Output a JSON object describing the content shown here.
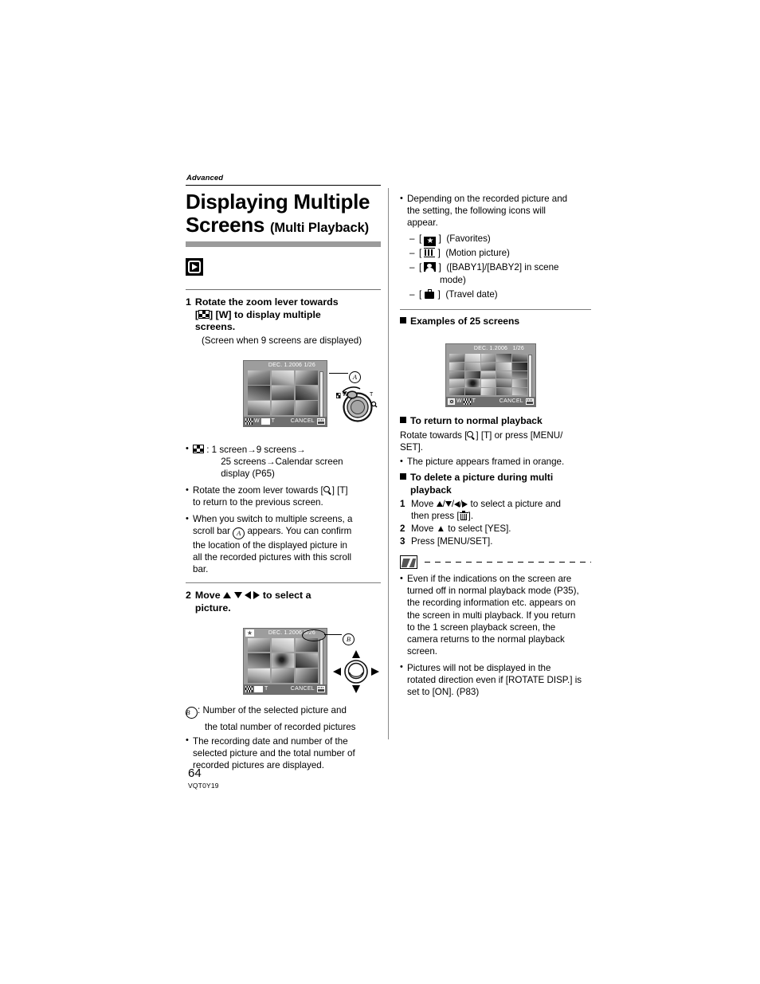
{
  "page": {
    "kicker": "Advanced",
    "number": "64",
    "doc_code": "VQT0Y19"
  },
  "title": {
    "main": "Displaying Multiple Screens",
    "line1": "Displaying Multiple",
    "line2": "Screens",
    "sub": "(Multi Playback)"
  },
  "left": {
    "step1": {
      "num": "1",
      "text_a": "Rotate the zoom lever towards",
      "text_b": "] [W] to display multiple",
      "text_c": "screens.",
      "bracket_open": "[",
      "caption": "(Screen when 9 screens are displayed)"
    },
    "fig1": {
      "date": "DEC. 1.2006",
      "count": "1/26",
      "bottom_w": "W",
      "bottom_t": "T",
      "cancel": "CANCEL",
      "callout": "A"
    },
    "bullets": [
      {
        "icon": "multi-screen-icon",
        "lines": [
          ": 1 screen→9 screens→",
          "25 screens→Calendar screen",
          "display (P65)"
        ]
      },
      {
        "icon": "magnify-icon",
        "lines": [
          "Rotate the zoom lever towards [",
          "] [T]",
          "to return to the previous screen."
        ]
      },
      {
        "icon": "circle-a",
        "lines": [
          "When you switch to multiple screens, a",
          "scroll bar ",
          " appears. You can confirm",
          "the location of the displayed picture in",
          "all the recorded pictures with this scroll",
          "bar."
        ]
      }
    ],
    "step2": {
      "num": "2",
      "text_a": "Move",
      "text_b": "to select a",
      "text_c": "picture."
    },
    "fig2": {
      "date": "DEC. 1.2006",
      "count": "5/26",
      "bottom_t": "T",
      "cancel": "CANCEL",
      "callout": "B"
    },
    "after_fig2": [
      {
        "label": "B",
        "lines": [
          ": Number of the selected picture and",
          "the total number of recorded pictures"
        ]
      },
      {
        "lines": [
          "The recording date and number of the",
          "selected picture and the total number of",
          "recorded pictures are displayed."
        ]
      }
    ]
  },
  "right": {
    "intro_bullet": [
      "Depending on the recorded picture and",
      "the setting, the following icons will",
      "appear."
    ],
    "icon_list": [
      {
        "icon": "favorites-icon",
        "label": "(Favorites)",
        "cont": ""
      },
      {
        "icon": "motion-picture-icon",
        "label": "(Motion picture)",
        "cont": ""
      },
      {
        "icon": "baby-icon",
        "label": "([BABY1]/[BABY2] in scene",
        "cont": "mode)"
      },
      {
        "icon": "travel-date-icon",
        "label": "(Travel date)",
        "cont": ""
      }
    ],
    "sec_examples": "Examples of 25 screens",
    "fig3": {
      "date": "DEC. 1.2006",
      "count": "1/26",
      "bottom_w": "W",
      "bottom_t": "T",
      "cancel": "CANCEL"
    },
    "sec_return": "To return to normal playback",
    "return_text_a": "Rotate towards [",
    "return_text_b": "] [T] or press [MENU/",
    "return_text_c": "SET].",
    "return_bullet": "The picture appears framed in orange.",
    "sec_delete_l1": "To delete a picture during multi",
    "sec_delete_l2": "playback",
    "delete_steps": [
      {
        "n": "1",
        "a": "Move ",
        "b": " to select a picture and",
        "c": "then press [",
        "d": "]."
      },
      {
        "n": "2",
        "t": "Move ▲ to select [YES]."
      },
      {
        "n": "3",
        "t": "Press [MENU/SET]."
      }
    ],
    "notes": [
      [
        "Even if the indications on the screen are",
        "turned off in normal playback mode (P35),",
        "the recording information etc. appears on",
        "the screen in multi playback. If you return",
        "to the 1 screen playback screen, the",
        "camera returns to the normal playback",
        "screen."
      ],
      [
        "Pictures will not be displayed in the",
        "rotated direction even if [ROTATE DISP.] is",
        "set to [ON]. (P83)"
      ]
    ]
  },
  "colors": {
    "screen_bg": "#9d9d9d",
    "screen_bar": "#6f6f6f",
    "title_bar": "#9b9b9b"
  }
}
